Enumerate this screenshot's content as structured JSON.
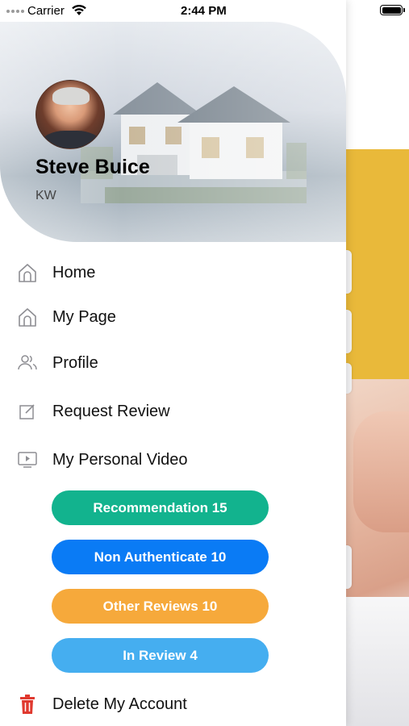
{
  "status_bar": {
    "carrier": "Carrier",
    "time": "2:44 PM"
  },
  "profile": {
    "name": "Steve Buice",
    "company": "KW"
  },
  "menu": {
    "items": [
      {
        "label": "Home",
        "icon": "home-icon"
      },
      {
        "label": "My Page",
        "icon": "home-icon"
      },
      {
        "label": "Profile",
        "icon": "people-icon"
      },
      {
        "label": "Request Review",
        "icon": "edit-icon"
      },
      {
        "label": "My Personal Video",
        "icon": "video-icon"
      }
    ],
    "delete_account": {
      "label": "Delete My Account",
      "icon": "trash-icon",
      "color": "#e0392f"
    }
  },
  "review_buttons": [
    {
      "label": "Recommendation 15",
      "color": "#12b38e"
    },
    {
      "label": "Non Authenticate 10",
      "color": "#0a7bf5"
    },
    {
      "label": "Other Reviews 10",
      "color": "#f6a93b"
    },
    {
      "label": "In Review 4",
      "color": "#45aef0"
    }
  ],
  "colors": {
    "background_accent": "#e9b93a",
    "icon_gray": "#8e8e93"
  }
}
